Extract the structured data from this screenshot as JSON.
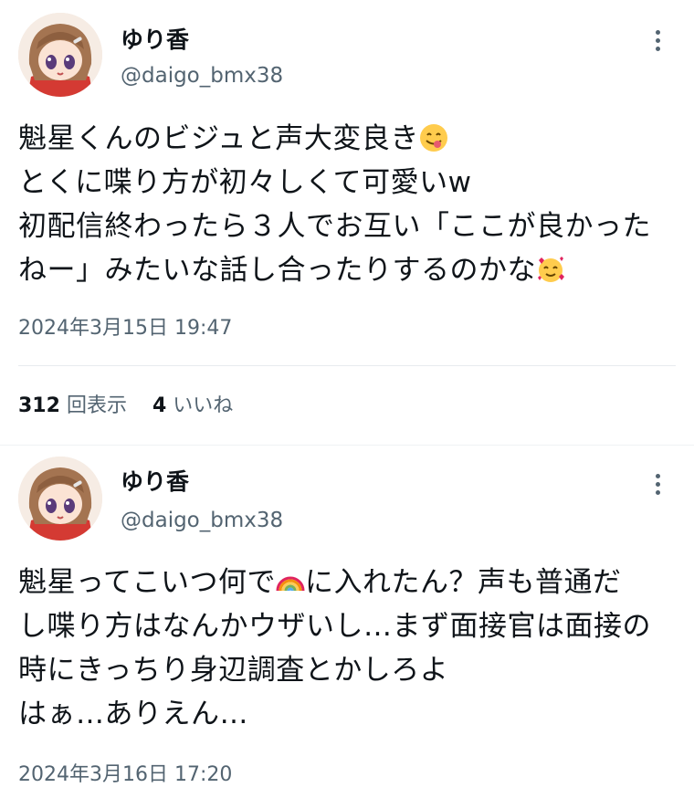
{
  "tweets": [
    {
      "display_name": "ゆり香",
      "handle": "@daigo_bmx38",
      "lines": [
        "魁星くんのビジュと声大変良き",
        "とくに喋り方が初々しくて可愛いw",
        "初配信終わったら３人でお互い「ここが良かった",
        "ねー」みたいな話し合ったりするのかな"
      ],
      "emojis": [
        "face-savoring-food-emoji",
        "smiling-face-with-hearts-emoji"
      ],
      "timestamp": "2024年3月15日 19:47",
      "views_count": "312",
      "views_label": "回表示",
      "likes_count": "4",
      "likes_label": "いいね"
    },
    {
      "display_name": "ゆり香",
      "handle": "@daigo_bmx38",
      "line1_a": "魁星ってこいつ何で",
      "line1_b": "に入れたん？声も普通だ",
      "lines_rest": [
        "し喋り方はなんかウザいし…まず面接官は面接の",
        "時にきっちり身辺調査とかしろよ",
        "はぁ…ありえん…"
      ],
      "emojis": [
        "rainbow-emoji"
      ],
      "timestamp": "2024年3月16日 17:20"
    }
  ]
}
